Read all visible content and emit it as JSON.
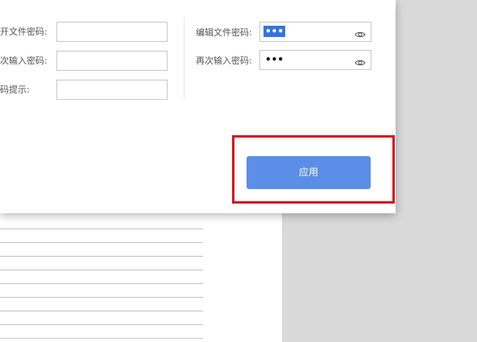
{
  "left_fields": {
    "open_password_label": "开文件密码:",
    "confirm_password_label": "次输入密码:",
    "hint_label": "码提示:",
    "open_password_value": "",
    "confirm_password_value": "",
    "hint_value": ""
  },
  "right_fields": {
    "edit_password_label": "编辑文件密码:",
    "edit_password_value": "•••",
    "confirm_password_label": "再次输入密码:",
    "confirm_password_value": "•••",
    "show_password_icon": "eye-icon"
  },
  "apply_button": {
    "label": "应用"
  },
  "colors": {
    "accent": "#5b8ee6",
    "highlight": "#d6121b",
    "selection": "#3574e0"
  }
}
